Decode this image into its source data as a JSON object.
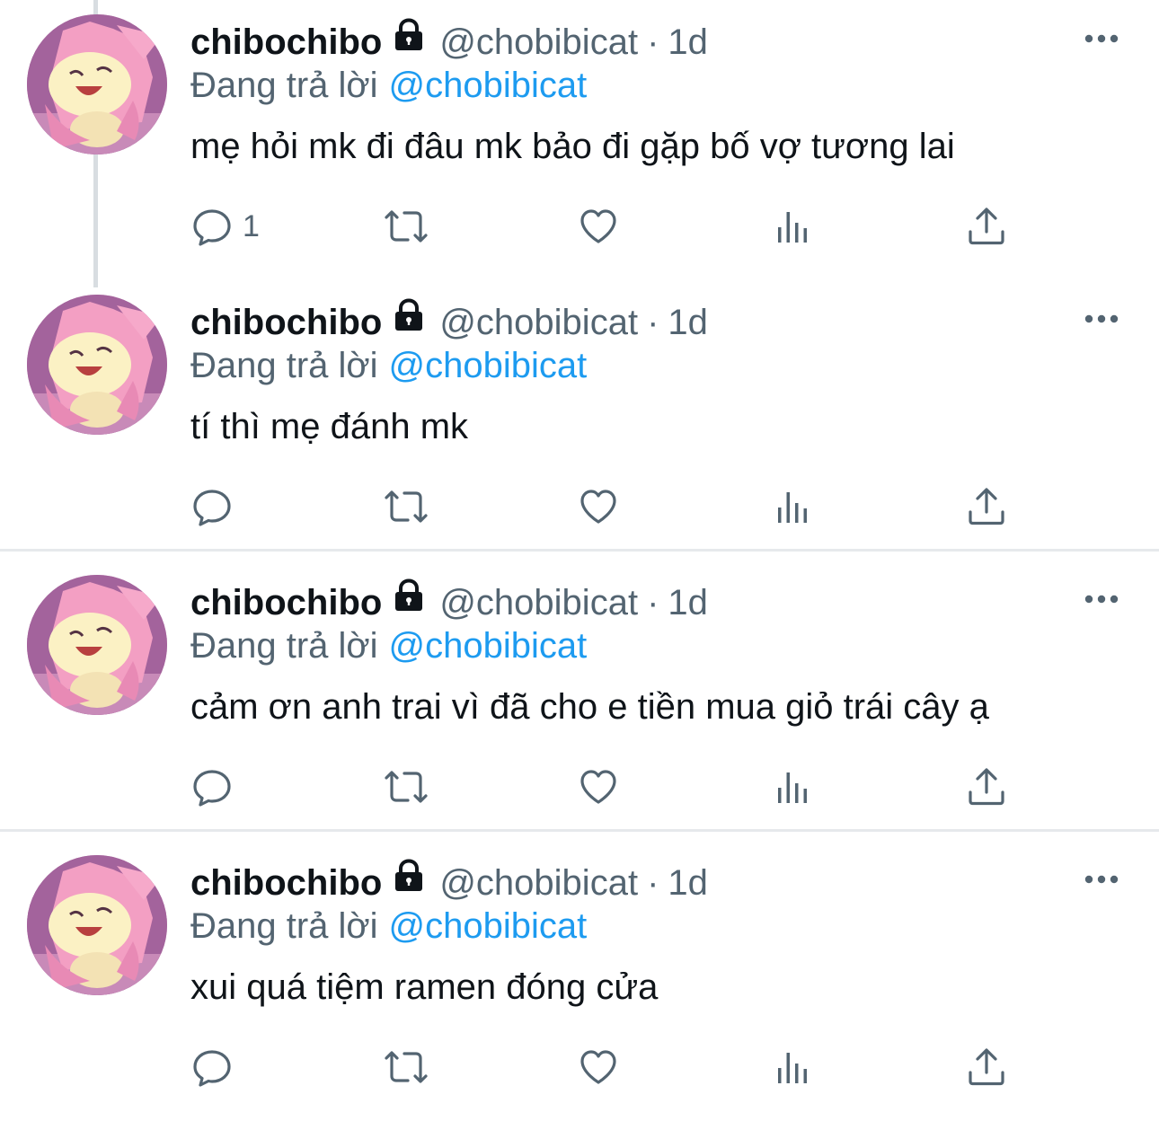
{
  "colors": {
    "accent": "#1d9bf0",
    "text": "#0f1419",
    "muted": "#536471",
    "divider": "#e6e9ec"
  },
  "tweets": [
    {
      "display_name": "chibochibo",
      "handle": "@chobibicat",
      "separator": "·",
      "time": "1d",
      "reply_prefix": "Đang trả lời",
      "reply_to": "@chobibicat",
      "text": "mẹ hỏi mk đi đâu mk bảo đi gặp bố vợ tương lai",
      "reply_count": "1",
      "icons": [
        "lock-icon",
        "reply-icon",
        "retweet-icon",
        "like-icon",
        "views-icon",
        "share-icon",
        "more-icon"
      ]
    },
    {
      "display_name": "chibochibo",
      "handle": "@chobibicat",
      "separator": "·",
      "time": "1d",
      "reply_prefix": "Đang trả lời",
      "reply_to": "@chobibicat",
      "text": "tí thì mẹ đánh mk",
      "reply_count": ""
    },
    {
      "display_name": "chibochibo",
      "handle": "@chobibicat",
      "separator": "·",
      "time": "1d",
      "reply_prefix": "Đang trả lời",
      "reply_to": "@chobibicat",
      "text": "cảm ơn anh trai vì đã cho e tiền mua giỏ trái cây ạ",
      "reply_count": ""
    },
    {
      "display_name": "chibochibo",
      "handle": "@chobibicat",
      "separator": "·",
      "time": "1d",
      "reply_prefix": "Đang trả lời",
      "reply_to": "@chobibicat",
      "text": "xui quá tiệm ramen đóng cửa",
      "reply_count": ""
    }
  ]
}
